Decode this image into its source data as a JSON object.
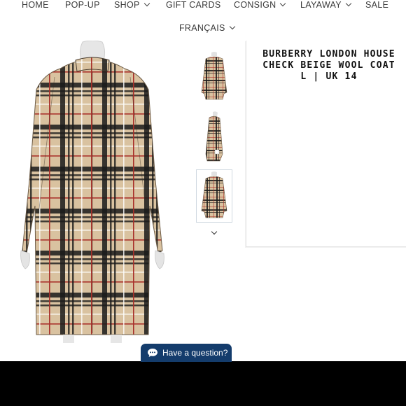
{
  "nav": {
    "items": [
      {
        "label": "HOME",
        "dropdown": false
      },
      {
        "label": "POP-UP",
        "dropdown": false
      },
      {
        "label": "SHOP",
        "dropdown": true
      },
      {
        "label": "GIFT CARDS",
        "dropdown": false
      },
      {
        "label": "CONSIGN",
        "dropdown": true
      },
      {
        "label": "LAYAWAY",
        "dropdown": true
      },
      {
        "label": "SALE",
        "dropdown": false
      }
    ],
    "language": "FRANÇAIS"
  },
  "product": {
    "title": "BURBERRY LONDON HOUSE\nCHECK BEIGE WOOL COAT\nL | UK 14"
  },
  "gallery": {
    "thumbnail_count": 3,
    "selected_thumbnail": 3
  },
  "chat": {
    "label": "Have a question?"
  },
  "colors": {
    "plaid_base": "#d9c2a0",
    "plaid_dark": "#1a1a1a",
    "plaid_red": "#a8302a",
    "chat_bg": "#143c6c",
    "bottom_bar": "#000000"
  }
}
